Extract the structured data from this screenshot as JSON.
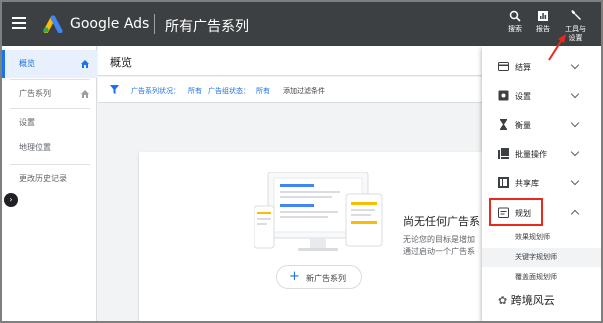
{
  "topbar": {
    "brand": "Google Ads",
    "page_title": "所有广告系列",
    "tools": [
      {
        "icon": "search-icon",
        "label": "搜索"
      },
      {
        "icon": "reports-icon",
        "label": "报告"
      },
      {
        "icon": "wrench-icon",
        "label_line1": "工具与",
        "label_line2": "设置"
      }
    ]
  },
  "sidebar": {
    "items": [
      {
        "label": "概览",
        "active": true
      },
      {
        "label": "广告系列",
        "active": false
      },
      {
        "label": "设置",
        "active": false
      },
      {
        "label": "地理位置",
        "active": false
      },
      {
        "label": "更改历史记录",
        "active": false
      }
    ],
    "collapse_glyph": "›"
  },
  "main": {
    "title": "概览",
    "filter": {
      "campaign_status_label": "广告系列状况：",
      "campaign_status_value": "所有",
      "adgroup_status_label": "广告组状态：",
      "adgroup_status_value": "所有",
      "add_filter": "添加过滤条件"
    },
    "empty_state": {
      "title": "尚无任何广告系",
      "desc_line1": "无论您的目标是增加",
      "desc_line2": "通过启动一个广告系",
      "button_label": "新广告系列"
    }
  },
  "tools_menu": {
    "sections": [
      {
        "icon": "billing-icon",
        "label": "结算",
        "expanded": false
      },
      {
        "icon": "settings-icon",
        "label": "设置",
        "expanded": false
      },
      {
        "icon": "measurement-icon",
        "label": "衡量",
        "expanded": false
      },
      {
        "icon": "bulk-actions-icon",
        "label": "批量操作",
        "expanded": false
      },
      {
        "icon": "shared-library-icon",
        "label": "共享库",
        "expanded": false
      },
      {
        "icon": "planning-icon",
        "label": "规划",
        "expanded": true
      }
    ],
    "planning_items": [
      "效果规划师",
      "关键字规划师",
      "覆盖面规划师"
    ]
  },
  "colors": {
    "topbar_bg": "#3c4043",
    "accent_blue": "#1a73e8",
    "highlight_red": "#e8291c"
  },
  "watermark": "跨境风云"
}
